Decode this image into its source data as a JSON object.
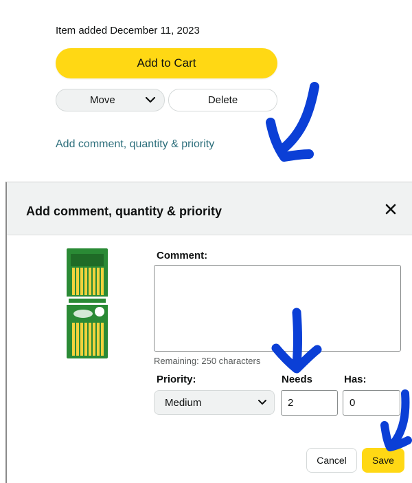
{
  "item": {
    "added_text": "Item added December 11, 2023",
    "add_to_cart": "Add to Cart",
    "move_label": "Move",
    "delete_label": "Delete",
    "comment_link": "Add comment, quantity & priority"
  },
  "modal": {
    "title": "Add comment, quantity & priority",
    "comment_label": "Comment:",
    "comment_value": "",
    "remaining": "Remaining: 250 characters",
    "priority_label": "Priority:",
    "priority_value": "Medium",
    "needs_label": "Needs",
    "needs_value": "2",
    "has_label": "Has:",
    "has_value": "0",
    "cancel": "Cancel",
    "save": "Save"
  },
  "colors": {
    "accent_yellow": "#ffd814",
    "link": "#2c6e7b",
    "annotation_arrow": "#0b3fd6"
  },
  "icons": [
    "chevron-down-icon",
    "close-icon",
    "annotation-arrow"
  ]
}
